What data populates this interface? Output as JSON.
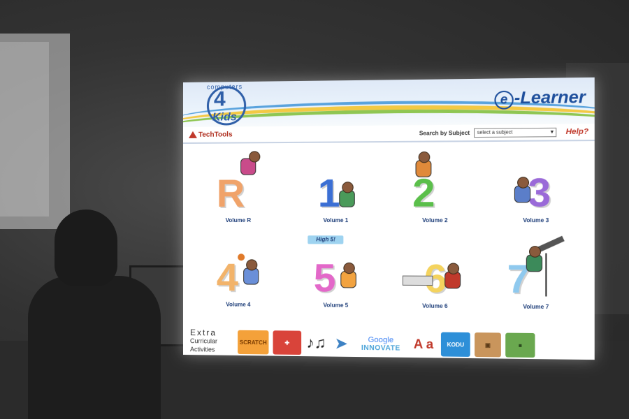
{
  "app": {
    "brand_top": "computers",
    "brand_number": "4",
    "brand_bottom": "Kids",
    "product_prefix": "e",
    "product_suffix": "-Learner"
  },
  "toolbar": {
    "brand_name": "TechTools",
    "search_label": "Search by Subject",
    "select_value": "select a subject",
    "help_label": "Help?"
  },
  "volumes": [
    {
      "glyph": "R",
      "label": "Volume R",
      "color": "#f0a36a"
    },
    {
      "glyph": "1",
      "label": "Volume 1",
      "color": "#3b6fd4"
    },
    {
      "glyph": "2",
      "label": "Volume 2",
      "color": "#5bbf4b"
    },
    {
      "glyph": "3",
      "label": "Volume 3",
      "color": "#9a6ad8"
    },
    {
      "glyph": "4",
      "label": "Volume 4",
      "color": "#f2b36a"
    },
    {
      "glyph": "5",
      "label": "Volume 5",
      "color": "#e368c9",
      "badge": "High 5!"
    },
    {
      "glyph": "6",
      "label": "Volume 6",
      "color": "#f4d35e"
    },
    {
      "glyph": "7",
      "label": "Volume 7",
      "color": "#8fc9ee"
    }
  ],
  "extras": {
    "title_line1": "Extra",
    "title_line2": "Curricular",
    "title_line3": "Activities",
    "tiles": {
      "scratch": "SCRATCH",
      "music": "♪♫",
      "google_top": "Google",
      "google_bottom": "INNOVATE",
      "kodu": "KODU",
      "apple": "A a"
    }
  },
  "icons": {
    "bird": "paper-plane-bird",
    "cardboard": "vr-cardboard",
    "minecraft": "minecraft-block",
    "redcard": "first-aid-card"
  }
}
